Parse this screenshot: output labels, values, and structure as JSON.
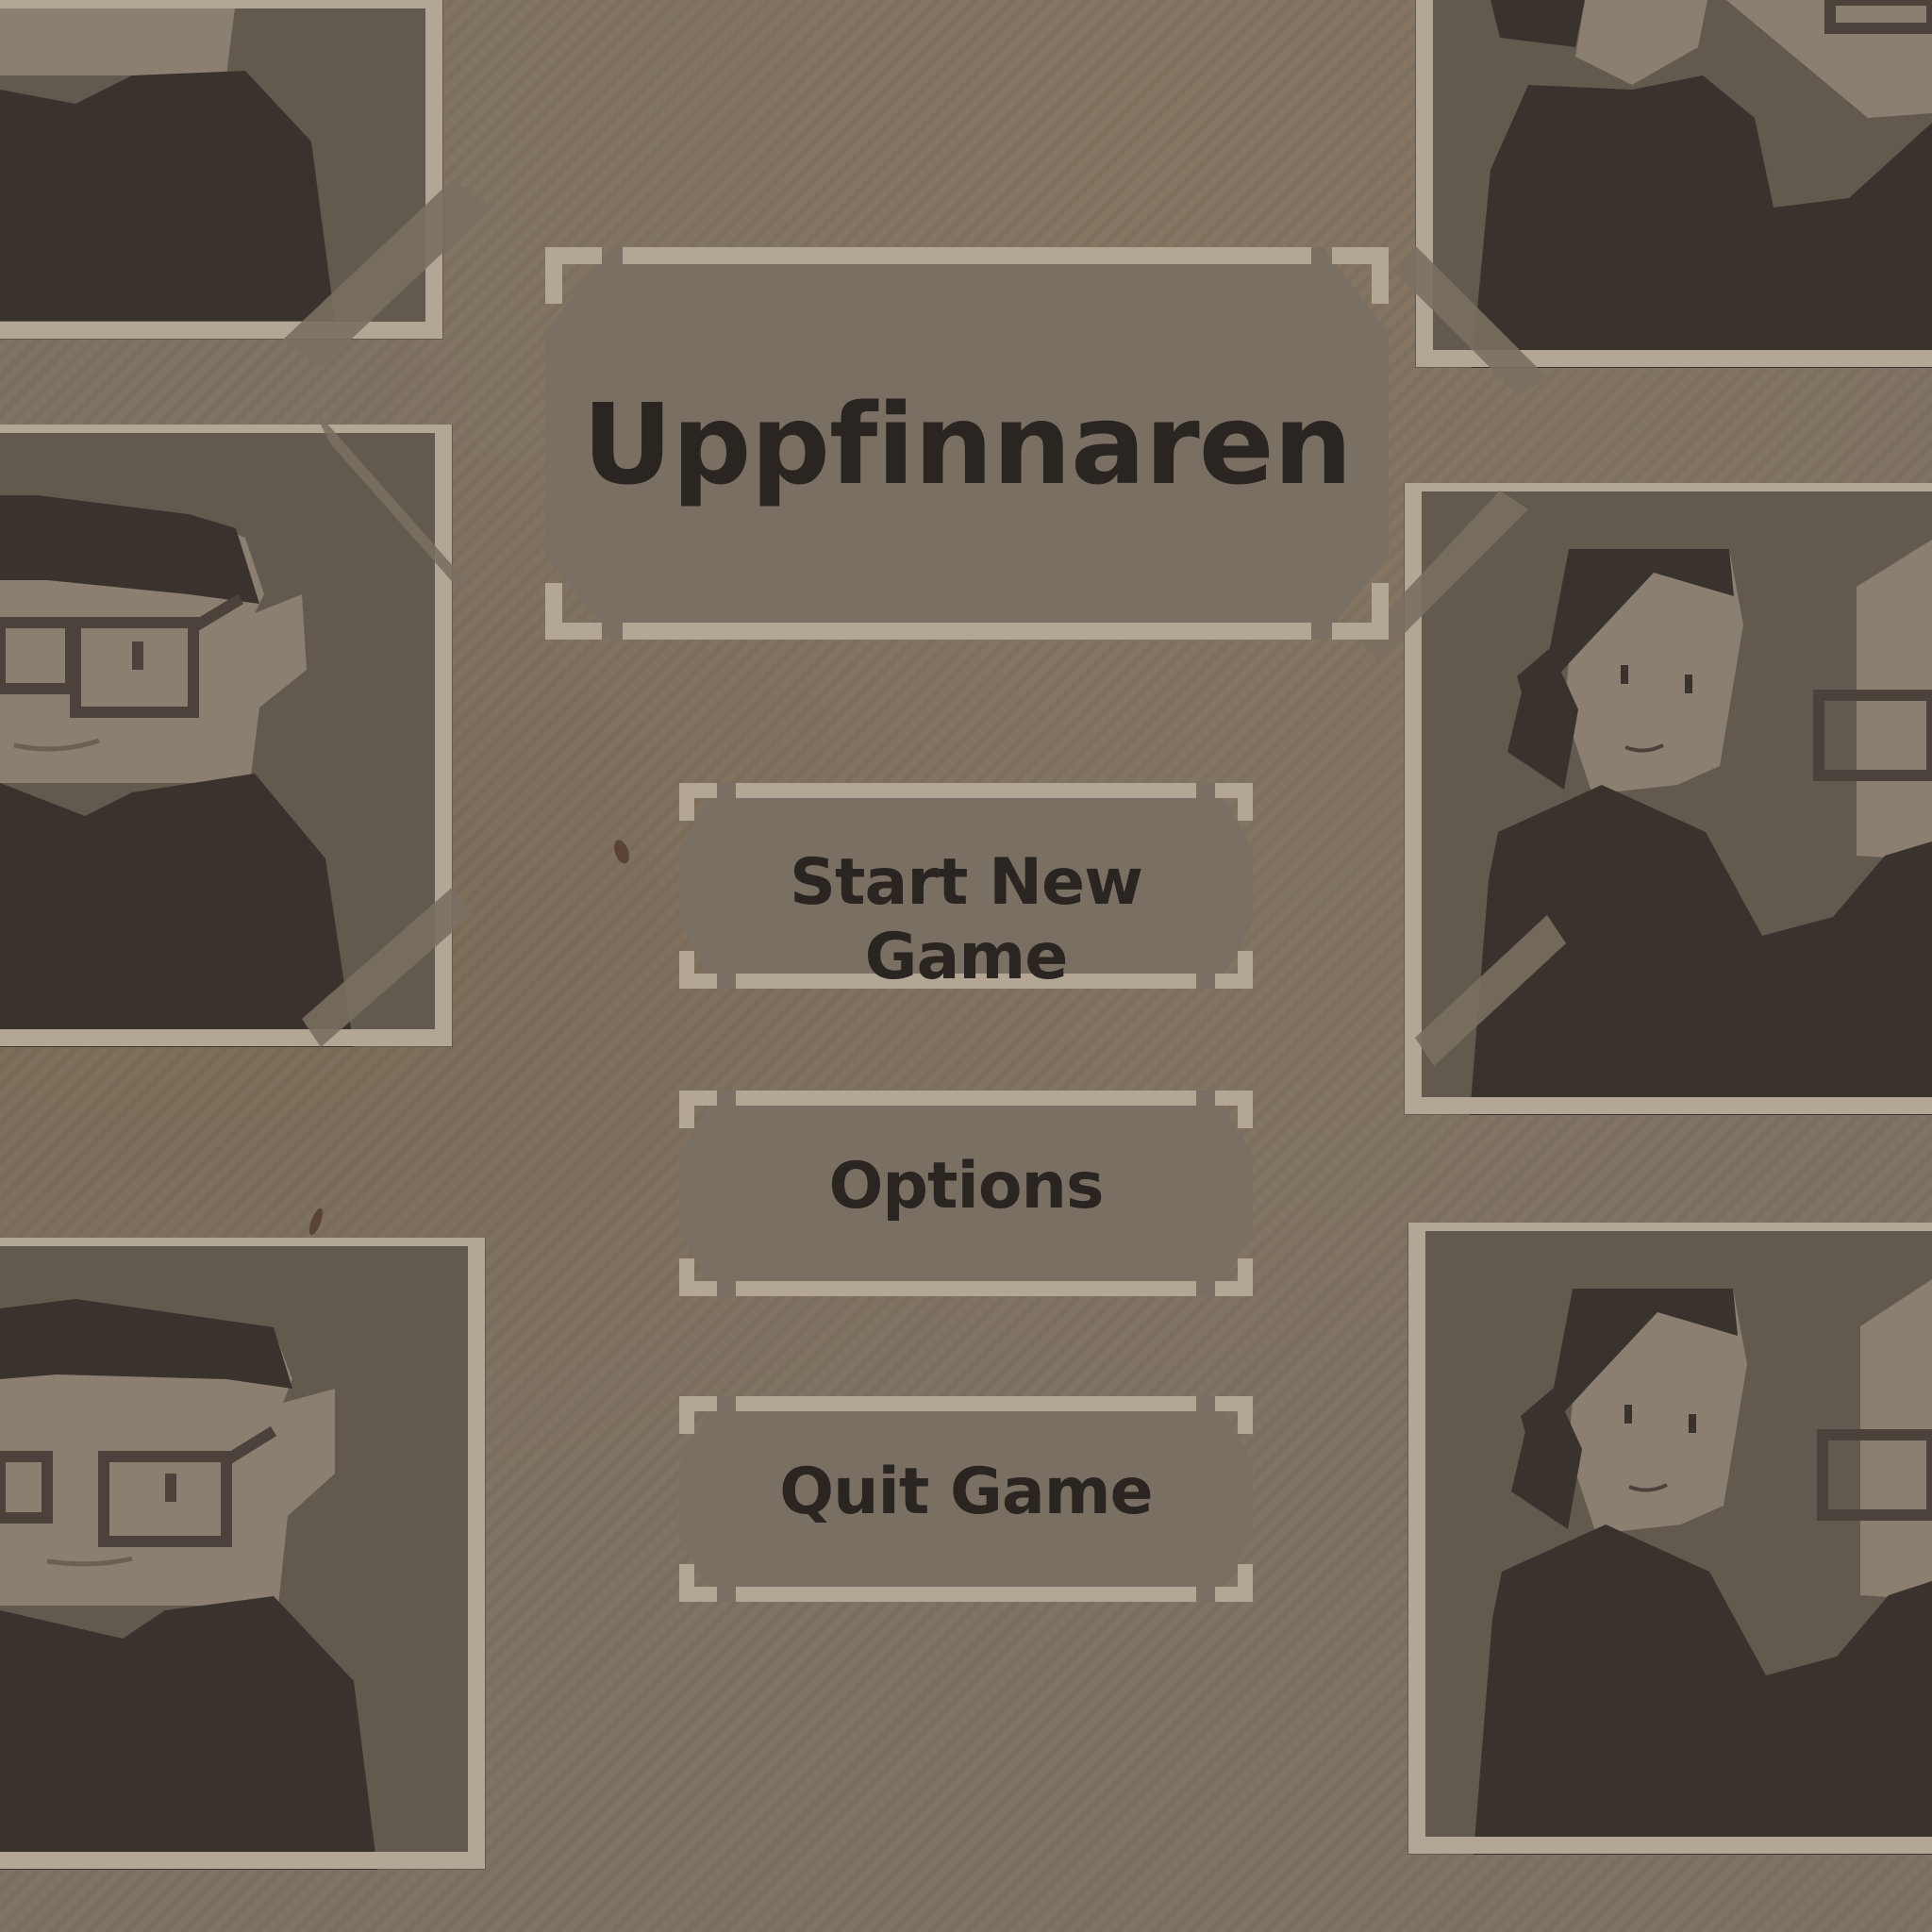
{
  "game": {
    "title": "Uppfinnaren"
  },
  "menu": {
    "start_label": "Start New Game",
    "options_label": "Options",
    "quit_label": "Quit Game"
  },
  "colors": {
    "background": "#7d7161",
    "panel": "#797063",
    "frame_border": "#b2a694",
    "text": "#2a2521",
    "portrait_bg": "#625a4f",
    "skin": "#8a7f71",
    "dark": "#3a332d"
  },
  "portraits": [
    {
      "name": "man-with-glasses"
    },
    {
      "name": "woman-with-ponytail"
    }
  ]
}
